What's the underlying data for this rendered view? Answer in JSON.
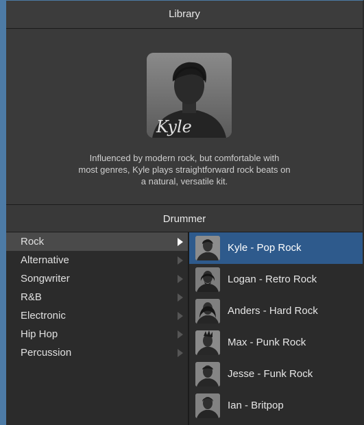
{
  "window": {
    "title": "Library"
  },
  "profile": {
    "signature": "Kyle",
    "description_lines": [
      "Influenced by modern rock, but comfortable with",
      "most genres, Kyle plays straightforward rock beats on",
      "a natural, versatile kit."
    ]
  },
  "section": {
    "title": "Drummer"
  },
  "genres": [
    {
      "label": "Rock",
      "selected": true
    },
    {
      "label": "Alternative",
      "selected": false
    },
    {
      "label": "Songwriter",
      "selected": false
    },
    {
      "label": "R&B",
      "selected": false
    },
    {
      "label": "Electronic",
      "selected": false
    },
    {
      "label": "Hip Hop",
      "selected": false
    },
    {
      "label": "Percussion",
      "selected": false
    }
  ],
  "drummers": [
    {
      "label": "Kyle - Pop Rock",
      "selected": true
    },
    {
      "label": "Logan - Retro Rock",
      "selected": false
    },
    {
      "label": "Anders - Hard Rock",
      "selected": false
    },
    {
      "label": "Max - Punk Rock",
      "selected": false
    },
    {
      "label": "Jesse - Funk Rock",
      "selected": false
    },
    {
      "label": "Ian - Britpop",
      "selected": false
    }
  ],
  "colors": {
    "selection_blue": "#2e5a8c",
    "panel_bg": "#2b2b2b",
    "header_bg": "#3c3c3c"
  }
}
